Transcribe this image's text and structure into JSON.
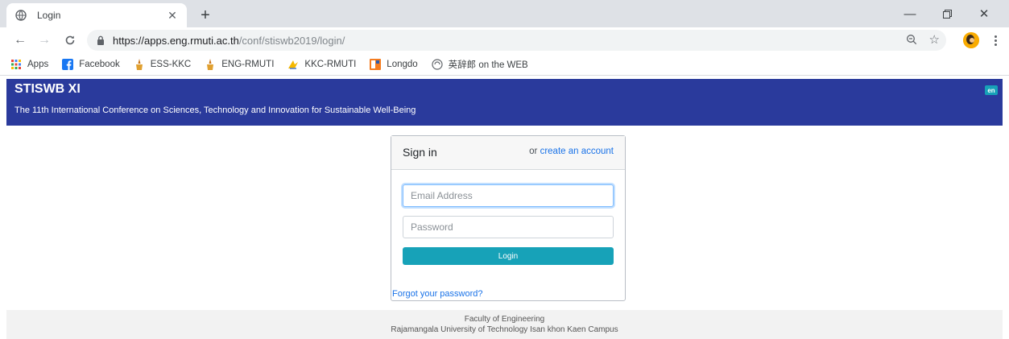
{
  "browser": {
    "tab": {
      "title": "Login"
    },
    "url": {
      "host": "https://apps.eng.rmuti.ac.th",
      "path": "/conf/stiswb2019/login/"
    },
    "bookmarks": [
      {
        "label": "Apps",
        "icon": "apps-grid-icon"
      },
      {
        "label": "Facebook",
        "icon": "facebook-icon"
      },
      {
        "label": "ESS-KKC",
        "icon": "ess-kkc-icon"
      },
      {
        "label": "ENG-RMUTI",
        "icon": "eng-rmuti-icon"
      },
      {
        "label": "KKC-RMUTI",
        "icon": "kkc-rmuti-icon"
      },
      {
        "label": "Longdo",
        "icon": "longdo-icon"
      },
      {
        "label": "英辞郎 on the WEB",
        "icon": "eijiro-icon"
      }
    ]
  },
  "header": {
    "title": "STISWB XI",
    "subtitle": "The 11th International Conference on Sciences, Technology and Innovation for Sustainable Well-Being",
    "lang_badge": "en",
    "bg_color": "#2a3a9c"
  },
  "login": {
    "heading": "Sign in",
    "or_text": "or ",
    "create_account": "create an account",
    "email_placeholder": "Email Address",
    "password_placeholder": "Password",
    "button_label": "Login",
    "forgot": "Forgot your password?",
    "accent_color": "#17a2b8"
  },
  "footer": {
    "line1": "Faculty of Engineering",
    "line2": "Rajamangala University of Technology Isan khon Kaen Campus"
  }
}
